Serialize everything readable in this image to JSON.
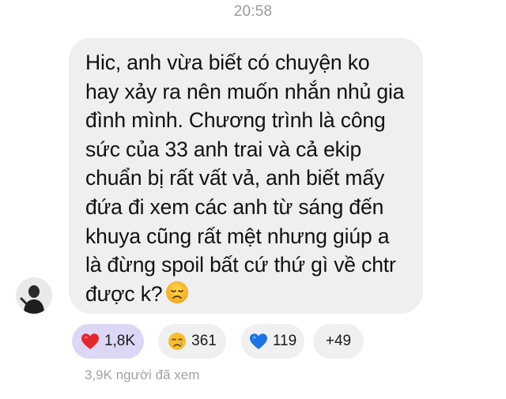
{
  "header": {
    "timestamp": "20:58"
  },
  "message": {
    "sender_avatar_icon": "avatar-icon",
    "lines": [
      "Hic, anh vừa biết có chuyện ko",
      "hay xảy ra nên muốn nhắn nhủ gia",
      "đình mình. Chương trình là công",
      "sức của 33 anh trai và cả ekip",
      "chuẩn bị rất vất vả, anh biết mấy",
      "đứa đi xem các anh từ sáng đến",
      "khuya cũng rất mệt nhưng giúp a",
      "là đừng spoil bất cứ thứ gì về chtr",
      "được k?"
    ],
    "trailing_emoji": "disappointed-face-icon"
  },
  "reactions": [
    {
      "icon": "red-heart-icon",
      "count": "1,8K",
      "selected": true
    },
    {
      "icon": "crying-face-icon",
      "count": "361",
      "selected": false
    },
    {
      "icon": "blue-heart-icon",
      "count": "119",
      "selected": false
    },
    {
      "icon": "",
      "count": "+49",
      "selected": false
    }
  ],
  "footer": {
    "views_text": "3,9K người đã xem"
  },
  "colors": {
    "bubble": "#efeff0",
    "reaction_selected": "#dcd7f5",
    "reaction_default": "#f0f0f1",
    "timestamp_text": "#9a9a9e"
  }
}
